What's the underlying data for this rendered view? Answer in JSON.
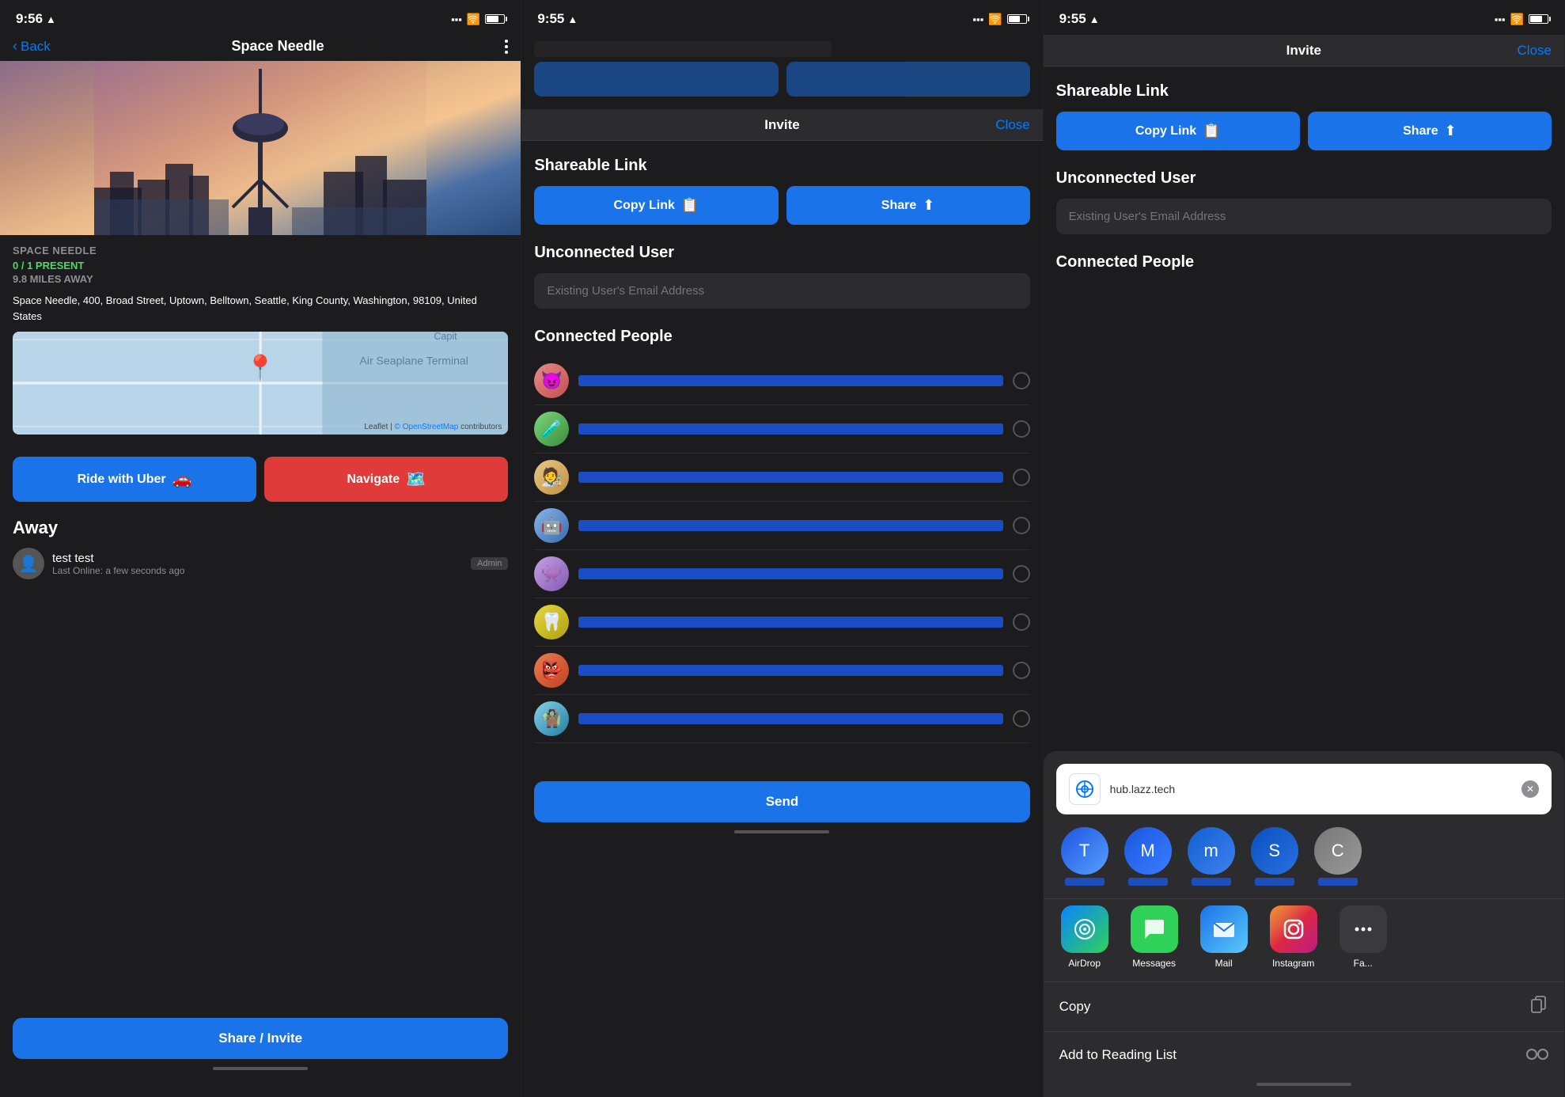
{
  "panel1": {
    "status_time": "9:56",
    "page_title": "Space Needle",
    "back_label": "Back",
    "location_name": "SPACE NEEDLE",
    "present_status": "0 / 1 PRESENT",
    "distance": "9.8 MILES AWAY",
    "address": "Space Needle, 400, Broad Street, Uptown, Belltown, Seattle, King County, Washington, 98109, United States",
    "leaflet_label": "Leaflet",
    "osm_label": "© OpenStreetMap",
    "osm_suffix": " contributors",
    "uber_label": "Ride with  Uber",
    "navigate_label": "Navigate",
    "away_title": "Away",
    "user_name": "test test",
    "user_status": "Last Online: a few seconds ago",
    "admin_label": "Admin",
    "share_invite_label": "Share / Invite"
  },
  "panel2": {
    "status_time": "9:55",
    "modal_title": "Invite",
    "close_label": "Close",
    "shareable_link_title": "Shareable Link",
    "copy_link_label": "Copy Link",
    "share_label": "Share",
    "unconnected_title": "Unconnected User",
    "email_placeholder": "Existing User's Email Address",
    "connected_title": "Connected People",
    "send_label": "Send",
    "people": [
      {
        "color": "av1"
      },
      {
        "color": "av2"
      },
      {
        "color": "av3"
      },
      {
        "color": "av4"
      },
      {
        "color": "av5"
      },
      {
        "color": "av6"
      },
      {
        "color": "av7"
      },
      {
        "color": "av8"
      }
    ]
  },
  "panel3": {
    "status_time": "9:55",
    "modal_title": "Invite",
    "close_label": "Close",
    "shareable_link_title": "Shareable Link",
    "copy_link_label": "Copy Link",
    "share_label": "Share",
    "unconnected_title": "Unconnected User",
    "email_placeholder": "Existing User's Email Address",
    "connected_title": "Connected People",
    "share_sheet": {
      "url": "hub.lazz.tech",
      "contacts": [
        {
          "label": "T..."
        },
        {
          "label": "Me..."
        },
        {
          "label": "mi..."
        },
        {
          "label": "S..."
        },
        {
          "label": "Ca..."
        }
      ],
      "apps": [
        {
          "name": "AirDrop",
          "class": "airdrop-icon"
        },
        {
          "name": "Messages",
          "class": "messages-icon"
        },
        {
          "name": "Mail",
          "class": "mail-icon"
        },
        {
          "name": "Instagram",
          "class": "instagram-icon"
        }
      ],
      "copy_label": "Copy",
      "reading_list_label": "Add to Reading List"
    }
  }
}
